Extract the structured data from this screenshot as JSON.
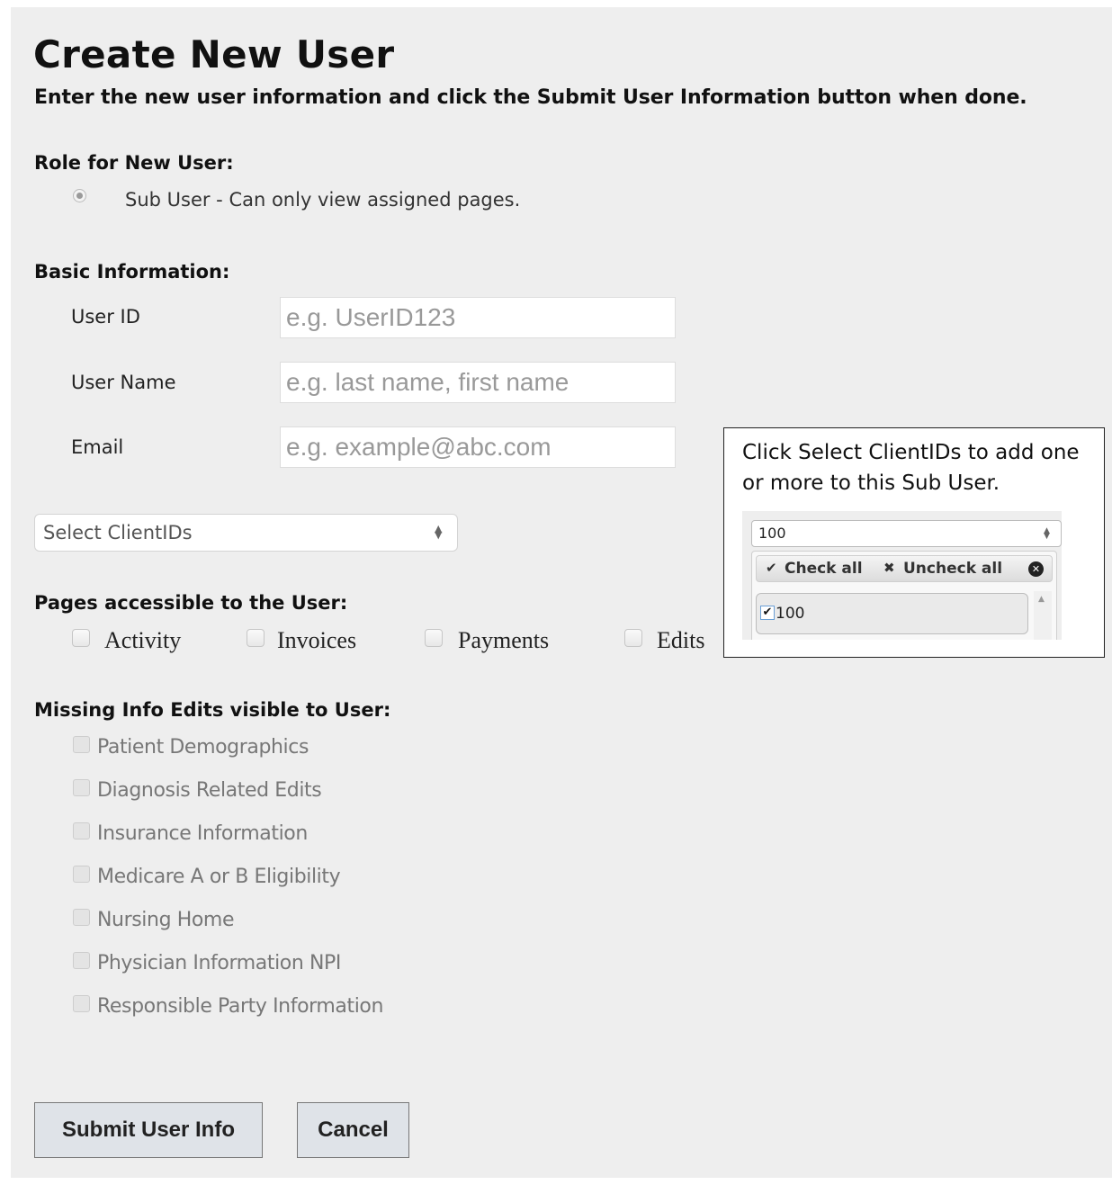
{
  "page": {
    "title": "Create New User",
    "subtitle": "Enter the new user information and click the Submit User Information button when done."
  },
  "role": {
    "label": "Role for New User:",
    "option": "Sub User - Can only view assigned pages.",
    "selected": true
  },
  "basic_info": {
    "label": "Basic Information:",
    "fields": [
      {
        "label": "User ID",
        "placeholder": "e.g. UserID123",
        "value": ""
      },
      {
        "label": "User Name",
        "placeholder": "e.g. last name, first name",
        "value": ""
      },
      {
        "label": "Email",
        "placeholder": "e.g. example@abc.com",
        "value": ""
      }
    ]
  },
  "client_select": {
    "value": "Select ClientIDs"
  },
  "pages": {
    "label": "Pages accessible to the User:",
    "items": [
      {
        "label": "Activity",
        "checked": false
      },
      {
        "label": "Invoices",
        "checked": false
      },
      {
        "label": "Payments",
        "checked": false
      },
      {
        "label": "Edits",
        "checked": false
      }
    ]
  },
  "missing_info": {
    "label": "Missing Info Edits visible to User:",
    "items": [
      {
        "label": "Patient Demographics",
        "checked": false,
        "disabled": true
      },
      {
        "label": "Diagnosis Related Edits",
        "checked": false,
        "disabled": true
      },
      {
        "label": "Insurance Information",
        "checked": false,
        "disabled": true
      },
      {
        "label": "Medicare A or B Eligibility",
        "checked": false,
        "disabled": true
      },
      {
        "label": "Nursing Home",
        "checked": false,
        "disabled": true
      },
      {
        "label": "Physician Information NPI",
        "checked": false,
        "disabled": true
      },
      {
        "label": "Responsible Party Information",
        "checked": false,
        "disabled": true
      }
    ]
  },
  "buttons": {
    "submit": "Submit User Info",
    "cancel": "Cancel"
  },
  "callout": {
    "text": "Click Select ClientIDs to add one or more to this Sub User.",
    "dropdown_value": "100",
    "check_all": "Check all",
    "uncheck_all": "Uncheck all",
    "item_label": "100",
    "item_checked": true
  },
  "icons": {
    "radio": "radio-selected-icon",
    "select_arrows": "updown-arrows-icon",
    "check": "checkmark-icon",
    "uncheck": "x-icon",
    "close": "close-circle-icon"
  },
  "colors": {
    "panel_bg": "#eeeeee",
    "button_bg": "#dfe3e8",
    "placeholder": "#999999"
  }
}
